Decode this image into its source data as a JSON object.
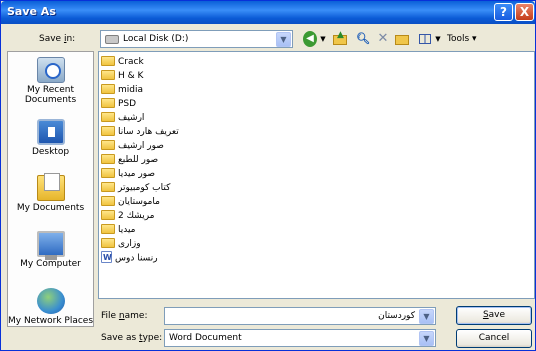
{
  "window": {
    "title": "Save As"
  },
  "titlebar": {
    "help_glyph": "?",
    "close_glyph": "X"
  },
  "toolbar": {
    "save_in_label_pre": "Save ",
    "save_in_label_u": "i",
    "save_in_label_post": "n:",
    "location": "Local Disk (D:)",
    "tools_label": "Tools ▾",
    "dropdown_glyph": "▼"
  },
  "places": [
    {
      "label": "My Recent Documents",
      "icon": "recent-documents-icon"
    },
    {
      "label": "Desktop",
      "icon": "desktop-icon"
    },
    {
      "label": "My Documents",
      "icon": "my-documents-icon"
    },
    {
      "label": "My Computer",
      "icon": "my-computer-icon"
    },
    {
      "label": "My Network Places",
      "icon": "network-places-icon"
    }
  ],
  "files": [
    {
      "name": "Crack",
      "type": "folder"
    },
    {
      "name": "H & K",
      "type": "folder"
    },
    {
      "name": "midia",
      "type": "folder"
    },
    {
      "name": "PSD",
      "type": "folder"
    },
    {
      "name": "ارشيف",
      "type": "folder"
    },
    {
      "name": "تعريف هارد سانا",
      "type": "folder"
    },
    {
      "name": "صور ارشيف",
      "type": "folder"
    },
    {
      "name": "صور للطبع",
      "type": "folder"
    },
    {
      "name": "صور ميديا",
      "type": "folder"
    },
    {
      "name": "كتاب كومبيوتر",
      "type": "folder"
    },
    {
      "name": "ماموستايان",
      "type": "folder"
    },
    {
      "name": "مريشك 2",
      "type": "folder"
    },
    {
      "name": "ميديا",
      "type": "folder"
    },
    {
      "name": "وزارى",
      "type": "folder"
    },
    {
      "name": "رنسنا دوس",
      "type": "document"
    }
  ],
  "form": {
    "file_name_label_pre": "File ",
    "file_name_label_u": "n",
    "file_name_label_post": "ame:",
    "file_name_value": "كوردستان",
    "save_type_label_pre": "Save as ",
    "save_type_label_u": "t",
    "save_type_label_post": "ype:",
    "save_type_value": "Word Document",
    "save_u": "S",
    "save_rest": "ave",
    "cancel_label": "Cancel"
  }
}
